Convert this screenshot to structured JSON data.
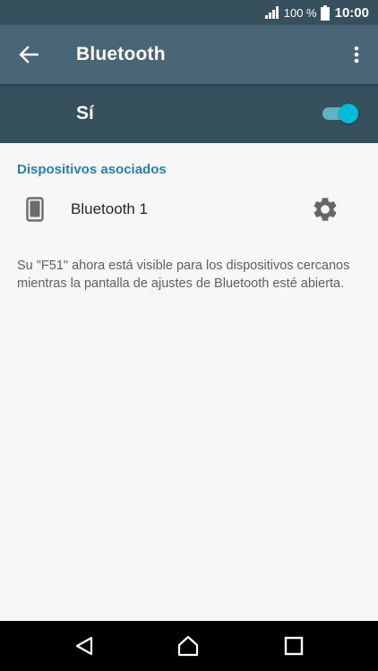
{
  "status_bar": {
    "battery_percent": "100 %",
    "time": "10:00"
  },
  "app_bar": {
    "title": "Bluetooth"
  },
  "master_switch": {
    "label": "Sí",
    "state": "on"
  },
  "paired_devices": {
    "header": "Dispositivos asociados",
    "items": [
      {
        "name": "Bluetooth 1"
      }
    ]
  },
  "visibility_message": "Su \"F51\" ahora está visible para los dispositivos cercanos mientras la pantalla de ajustes de Bluetooth esté abierta.",
  "colors": {
    "status_bar": "#37505d",
    "app_bar": "#4a6676",
    "switch_bar": "#37505d",
    "accent": "#00bcd4",
    "section_header": "#2b7fa8"
  },
  "icons": {
    "back": "arrow-back-icon",
    "more": "more-vert-icon",
    "device": "phone-icon",
    "settings": "gear-icon",
    "nav_back": "triangle-back-icon",
    "nav_home": "home-icon",
    "nav_recents": "square-recents-icon"
  }
}
